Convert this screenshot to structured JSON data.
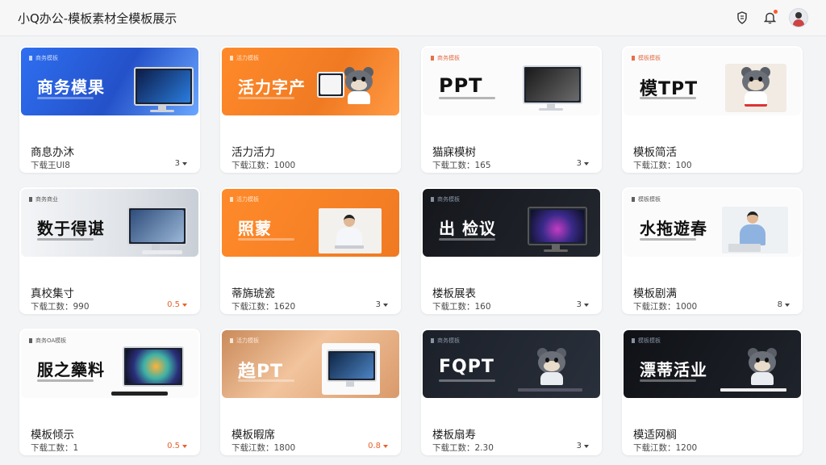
{
  "app": {
    "title": "小Q办公-模板素材全模板展示",
    "icons": [
      "shield-icon",
      "bell-icon",
      "user-avatar"
    ],
    "notification_color": "#ff5a2d"
  },
  "cards": [
    {
      "thumb_tag": "商务模板",
      "thumb_title": "商务模果",
      "title": "商息办沐",
      "meta": "下载王UI8",
      "action": "3",
      "accent": false,
      "theme": "blue"
    },
    {
      "thumb_tag": "活力模板",
      "thumb_title": "活力字产",
      "title": "活力活力",
      "meta": "下载江数：1000",
      "action": "",
      "accent": false,
      "theme": "orange"
    },
    {
      "thumb_tag": "商务模板",
      "thumb_title": "PPT",
      "title": "猫寐模树",
      "meta": "下载工数：165",
      "action": "3",
      "accent": false,
      "theme": "white"
    },
    {
      "thumb_tag": "模板模板",
      "thumb_title": "模TPT",
      "title": "模板简活",
      "meta": "下载江数：100",
      "action": "",
      "accent": false,
      "theme": "white-mascot"
    },
    {
      "thumb_tag": "商务商业",
      "thumb_title": "数于得谌",
      "title": "真校集寸",
      "meta": "下载工数：990",
      "action": "0.5",
      "accent": true,
      "theme": "office"
    },
    {
      "thumb_tag": "活力模板",
      "thumb_title": "照蒙",
      "title": "蒂旆琥瓷",
      "meta": "下载江数：1620",
      "action": "3",
      "accent": false,
      "theme": "orange-person"
    },
    {
      "thumb_tag": "商务模板",
      "thumb_title": "出 检议",
      "title": "楼板展表",
      "meta": "下载工数：160",
      "action": "3",
      "accent": false,
      "theme": "dark"
    },
    {
      "thumb_tag": "模板模板",
      "thumb_title": "水拖遊春",
      "title": "模板剧满",
      "meta": "下载江数：1000",
      "action": "8",
      "accent": false,
      "theme": "white-person"
    },
    {
      "thumb_tag": "商务OA模板",
      "thumb_title": "服之藥料",
      "title": "模板倾示",
      "meta": "下载工数：1",
      "action": "0.5",
      "accent": true,
      "theme": "white-monitor"
    },
    {
      "thumb_tag": "活力模板",
      "thumb_title": "趋PT",
      "title": "模板暇席",
      "meta": "下载江数：1800",
      "action": "0.8",
      "accent": true,
      "theme": "peach"
    },
    {
      "thumb_tag": "商务模板",
      "thumb_title": "FQPT",
      "title": "楼板扇寿",
      "meta": "下载工数：2.30",
      "action": "3",
      "accent": false,
      "theme": "dark-mascot"
    },
    {
      "thumb_tag": "模板模板",
      "thumb_title": "漂蒂活业",
      "title": "模适网榈",
      "meta": "下载江数：1200",
      "action": "",
      "accent": false,
      "theme": "black-mascot"
    }
  ]
}
